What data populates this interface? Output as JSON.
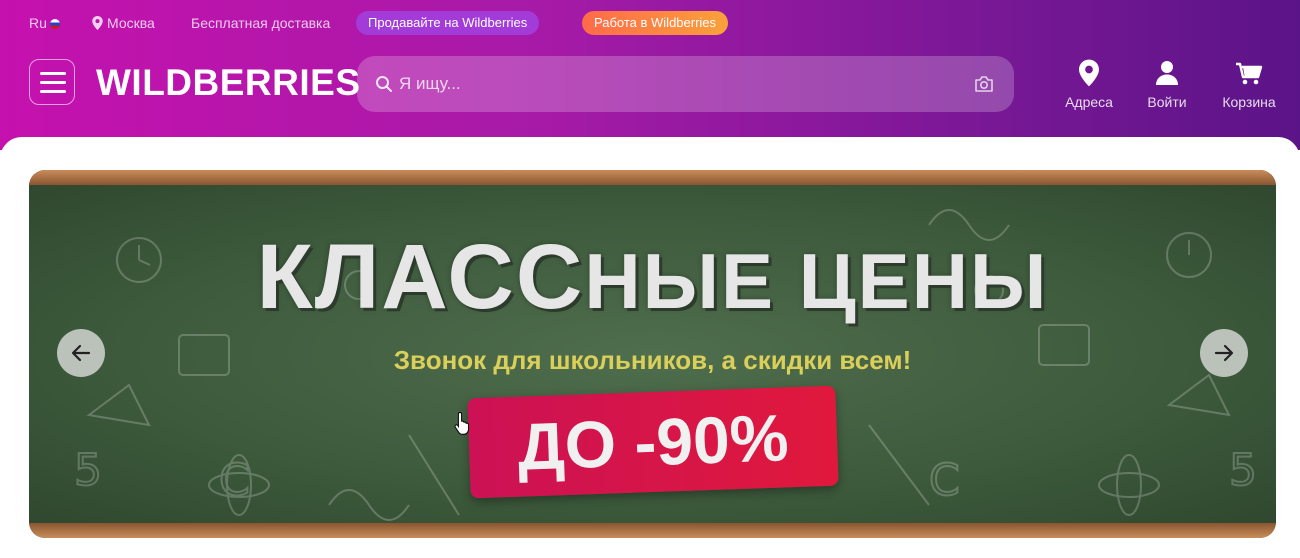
{
  "topbar": {
    "lang": "Ru",
    "city": "Москва",
    "delivery": "Бесплатная доставка",
    "sell_label": "Продавайте на Wildberries",
    "job_label": "Работа в Wildberries"
  },
  "header": {
    "logo": "WILDBERRIES",
    "search_placeholder": "Я ищу...",
    "nav": {
      "addresses": "Адреса",
      "login": "Войти",
      "cart": "Корзина"
    }
  },
  "banner": {
    "headline_big": "КЛАСС",
    "headline_small": "НЫЕ ЦЕНЫ",
    "subline": "Звонок для школьников, а скидки всем!",
    "discount": "ДО -90%"
  },
  "colors": {
    "header_start": "#c511ae",
    "header_end": "#5b1487",
    "sell_pill": "#a23bd8",
    "job_pill": "#ff6a4a",
    "discount_badge": "#e0183c"
  },
  "icons": [
    "flag-ru-icon",
    "pin-icon",
    "menu-icon",
    "search-icon",
    "camera-icon",
    "user-icon",
    "cart-icon",
    "arrow-left-icon",
    "arrow-right-icon"
  ]
}
